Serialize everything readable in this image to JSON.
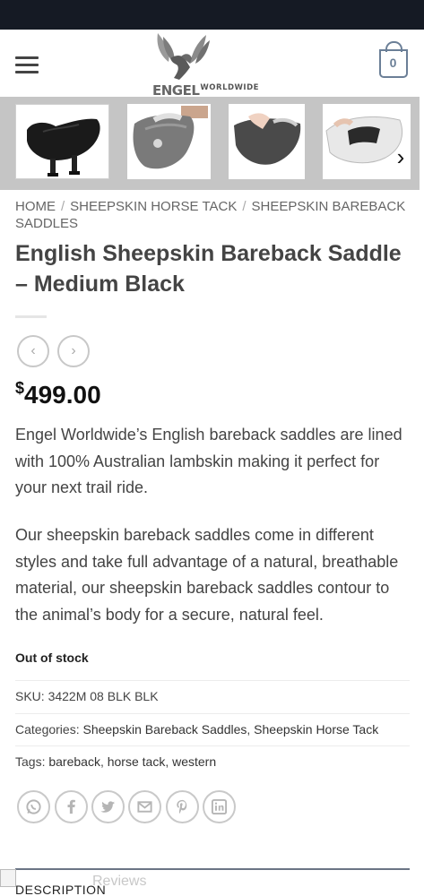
{
  "header": {
    "logo_main": "ENGEL",
    "logo_sub": "WORLDWIDE",
    "cart_count": "0"
  },
  "breadcrumb": {
    "items": [
      "HOME",
      "SHEEPSKIN HORSE TACK",
      "SHEEPSKIN BAREBACK SADDLES"
    ],
    "separator": "/"
  },
  "product": {
    "title": "English Sheepskin Bareback Saddle – Medium Black",
    "currency_symbol": "$",
    "price": "499.00",
    "description_1": "Engel Worldwide’s English bareback saddles are lined with 100% Australian lambskin making it perfect for your next trail ride.",
    "description_2": "Our sheepskin bareback saddles come in different styles and take full advantage of a natural, breathable material, our sheepskin bareback saddles contour to the animal’s body for a secure, natural feel.",
    "stock_status": "Out of stock",
    "sku_label": "SKU:",
    "sku": "3422M 08 BLK BLK",
    "categories_label": "Categories:",
    "categories": [
      "Sheepskin Bareback Saddles",
      "Sheepskin Horse Tack"
    ],
    "tags_label": "Tags:",
    "tags": [
      "bareback",
      "horse tack",
      "western"
    ]
  },
  "gallery": {
    "icons": [
      "saddle-black-icon",
      "saddle-on-person-icon",
      "saddle-handled-icon",
      "saddle-pocket-icon"
    ],
    "next_arrow": "›"
  },
  "nav": {
    "prev": "‹",
    "next": "›"
  },
  "share": {
    "icons": [
      "whatsapp-icon",
      "facebook-icon",
      "twitter-icon",
      "email-icon",
      "pinterest-icon",
      "linkedin-icon"
    ]
  },
  "tabs": {
    "reviews": "Reviews",
    "description": "DESCRIPTION"
  },
  "colors": {
    "status_bar": "#151a24",
    "accent": "#6b7f97",
    "text": "#444444"
  }
}
